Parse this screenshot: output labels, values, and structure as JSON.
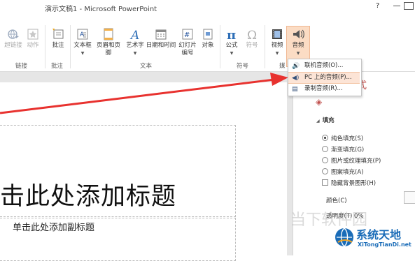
{
  "window": {
    "title": "演示文稿1 - Microsoft PowerPoint",
    "help": "?"
  },
  "ribbon": {
    "buttons": [
      {
        "label": "超链接"
      },
      {
        "label": "动作"
      },
      {
        "label": "批注"
      },
      {
        "label": "文本框"
      },
      {
        "label": "页眉和页脚"
      },
      {
        "label": "艺术字"
      },
      {
        "label": "日期和时间"
      },
      {
        "label": "幻灯片",
        "label2": "编号"
      },
      {
        "label": "对象"
      },
      {
        "label": "公式"
      },
      {
        "label": "符号"
      },
      {
        "label": "视频"
      },
      {
        "label": "音频"
      }
    ],
    "groups": [
      "链接",
      "批注",
      "文本",
      "符号",
      "媒"
    ]
  },
  "audio_menu": {
    "items": [
      {
        "label": "联机音频(O)...",
        "icon": "online-audio-icon"
      },
      {
        "label": "PC 上的音频(P)...",
        "icon": "speaker-icon"
      },
      {
        "label": "录制音频(R)...",
        "icon": "record-icon"
      }
    ]
  },
  "slide": {
    "title_placeholder": "击此处添加标题",
    "subtitle_placeholder": "单击此处添加副标题"
  },
  "format_pane": {
    "title": "式",
    "section": "填充",
    "options": [
      "纯色填充(S)",
      "渐变填充(G)",
      "图片或纹理填充(P)",
      "图案填充(A)"
    ],
    "checkbox": "隐藏背景图形(H)",
    "color_label": "颜色(C)",
    "transparency_label": "透明度(T)",
    "transparency_value": "0%"
  },
  "watermark": {
    "text": "当下软件园",
    "logo_text": "系统天地",
    "logo_url": "XiTongTianDi.net"
  },
  "colors": {
    "accent": "#c0504d",
    "highlight": "#fbdcc4",
    "arrow": "#e8322f",
    "logo": "#1a6cb8"
  }
}
